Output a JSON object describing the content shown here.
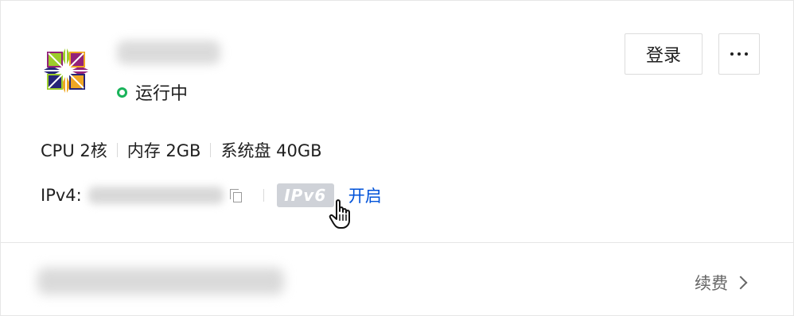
{
  "instance": {
    "status": "运行中",
    "status_color": "#19b35a"
  },
  "actions": {
    "login_label": "登录",
    "more_icon": "more-horizontal-icon"
  },
  "specs": {
    "cpu": "CPU 2核",
    "memory": "内存 2GB",
    "disk": "系统盘 40GB"
  },
  "network": {
    "ipv4_label": "IPv4:",
    "ipv6_badge": "IPv6",
    "ipv6_action": "开启",
    "ipv6_action_color": "#0052d9"
  },
  "footer": {
    "renew_label": "续费"
  },
  "os_logo": "centos-logo"
}
